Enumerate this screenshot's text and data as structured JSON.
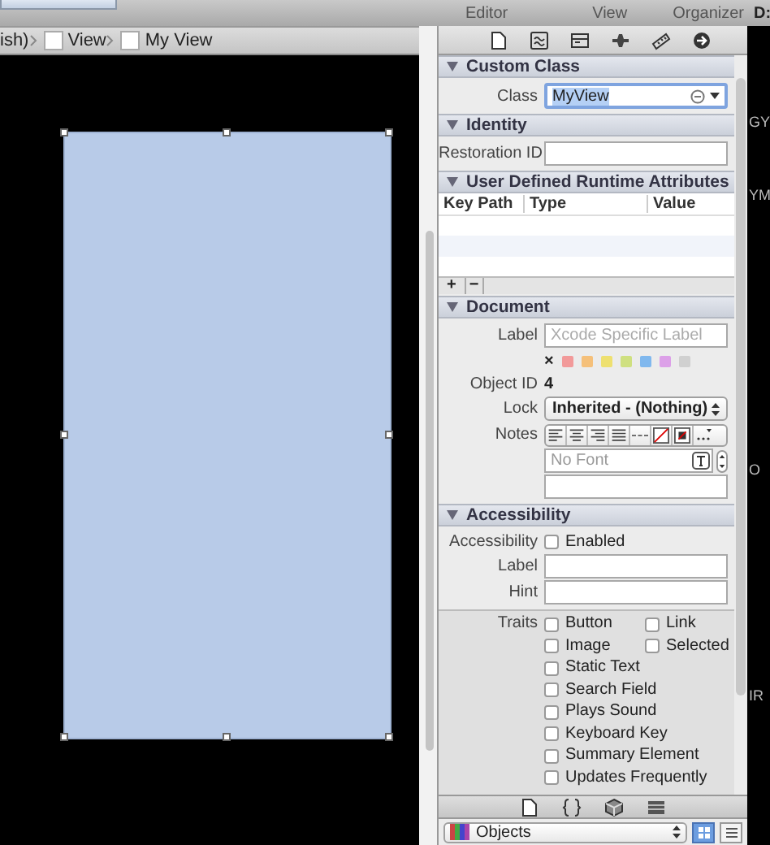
{
  "toolbar": {
    "menus": [
      "Editor",
      "View",
      "Organizer"
    ],
    "cut_text": "D:"
  },
  "jump_bar": {
    "items": [
      {
        "text": "ish)",
        "icon": false
      },
      {
        "text": "View",
        "icon": true
      },
      {
        "text": "My View",
        "icon": true
      }
    ]
  },
  "canvas": {
    "view": {
      "selected": true
    }
  },
  "sections": [
    {
      "title": "Custom Class",
      "expanded": true,
      "rows": [
        {
          "kind": "combo",
          "label": "Class",
          "value": "MyView",
          "text_selected": true
        }
      ]
    },
    {
      "title": "Identity",
      "expanded": true,
      "rows": [
        {
          "kind": "field",
          "label": "Restoration ID"
        }
      ]
    },
    {
      "title": "User Defined Runtime Attributes",
      "expanded": true,
      "rows": [
        {
          "kind": "table",
          "columns": [
            "Key Path",
            "Type",
            "Value"
          ],
          "add": "+",
          "remove": "−"
        }
      ]
    },
    {
      "title": "Document",
      "expanded": true,
      "rows": [
        {
          "kind": "field",
          "label": "Label",
          "placeholder": "Xcode Specific Label"
        },
        {
          "kind": "swatches",
          "clear": "×",
          "colors": [
            {
              "color": "#f29a9a"
            },
            {
              "color": "#f5c07a"
            },
            {
              "color": "#eee070"
            },
            {
              "color": "#cfe080"
            },
            {
              "color": "#80b8ee"
            },
            {
              "color": "#dca0e8"
            },
            {
              "color": "#d0d0d0"
            }
          ]
        },
        {
          "kind": "text",
          "label": "Object ID",
          "value": "4"
        },
        {
          "kind": "popup",
          "label": "Lock",
          "value": "Inherited - (Nothing)"
        },
        {
          "kind": "notes",
          "label": "Notes"
        },
        {
          "kind": "font",
          "placeholder": "No Font"
        },
        {
          "kind": "field"
        }
      ]
    },
    {
      "title": "Accessibility",
      "expanded": true,
      "rows": [
        {
          "kind": "checkbox",
          "label": "Accessibility",
          "text": "Enabled",
          "checked": false
        },
        {
          "kind": "field",
          "label": "Label"
        },
        {
          "kind": "field",
          "label": "Hint"
        },
        {
          "kind": "traits",
          "label": "Traits",
          "items": [
            [
              {
                "text": "Button",
                "checked": false
              },
              {
                "text": "Link",
                "checked": false
              }
            ],
            [
              {
                "text": "Image",
                "checked": false
              },
              {
                "text": "Selected",
                "checked": false
              }
            ],
            [
              {
                "text": "Static Text",
                "checked": false
              }
            ],
            [
              {
                "text": "Search Field",
                "checked": false
              }
            ],
            [
              {
                "text": "Plays Sound",
                "checked": false
              }
            ],
            [
              {
                "text": "Keyboard Key",
                "checked": false
              }
            ],
            [
              {
                "text": "Summary Element",
                "checked": false
              }
            ],
            [
              {
                "text": "Updates Frequently",
                "checked": false
              }
            ]
          ]
        }
      ]
    }
  ],
  "library": {
    "value": "Objects",
    "view_modes": [
      {
        "selected": true
      },
      {
        "selected": false
      }
    ]
  },
  "edge_texts": [
    "GY",
    "YM",
    "O",
    "IR"
  ]
}
